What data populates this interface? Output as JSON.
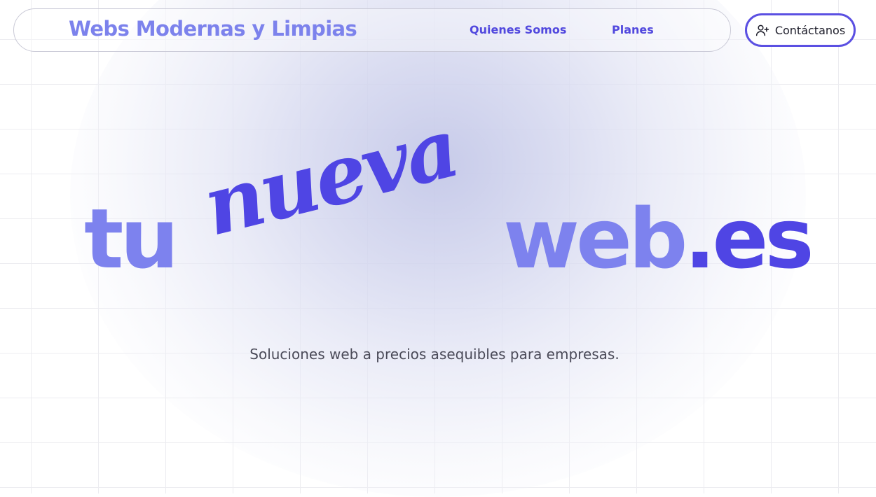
{
  "header": {
    "brand": "Webs Modernas y Limpias",
    "nav": {
      "about": "Quienes Somos",
      "plans": "Planes"
    },
    "contact_button": {
      "label": "Contáctanos",
      "icon": "user-plus-icon"
    }
  },
  "hero": {
    "word_tu": "tu",
    "word_nueva": "nueva",
    "word_web": "web",
    "word_tld": ".es",
    "tagline": "Soluciones web a precios asequibles para empresas."
  },
  "colors": {
    "accent_light": "#7d82ee",
    "accent_dark": "#4f45e4",
    "text_muted": "#4a4a58"
  }
}
